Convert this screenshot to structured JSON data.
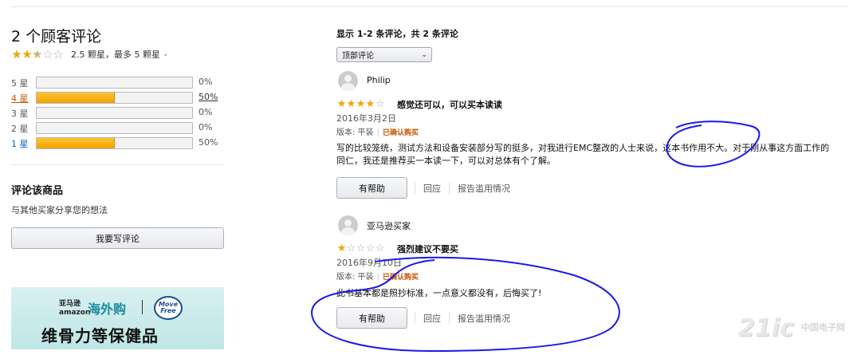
{
  "summary": {
    "title": "2 个顾客评论",
    "rating": 2.5,
    "rating_text": "2.5 颗星，最多 5 颗星",
    "caret": "⌄"
  },
  "histogram": [
    {
      "label": "5 星",
      "percent_text": "0%",
      "percent": 0,
      "link": false,
      "active": false
    },
    {
      "label": "4 星",
      "percent_text": "50%",
      "percent": 50,
      "link": true,
      "active": true
    },
    {
      "label": "3 星",
      "percent_text": "0%",
      "percent": 0,
      "link": false,
      "active": false
    },
    {
      "label": "2 星",
      "percent_text": "0%",
      "percent": 0,
      "link": false,
      "active": false
    },
    {
      "label": "1 星",
      "percent_text": "50%",
      "percent": 50,
      "link": true,
      "active": false
    }
  ],
  "review_prompt": {
    "heading": "评论该商品",
    "sub": "与其他买家分享您的想法",
    "button": "我要写评论"
  },
  "ad": {
    "brand_cn": "亚马逊",
    "brand_en": "amazon",
    "haiwai": "海外购",
    "badge_line1": "Move",
    "badge_line2": "Free",
    "headline": "维骨力等保健品"
  },
  "reviews_header": {
    "showing": "显示 1-2 条评论，共 2 条评论",
    "sort_value": "顶部评论"
  },
  "reviews": [
    {
      "name": "Philip",
      "stars": 4,
      "title": "感觉还可以，可以买本读读",
      "date": "2016年3月2日",
      "format": "版本: 平装",
      "verified": "已确认购买",
      "body": "写的比较笼统，测试方法和设备安装部分写的挺多，对我进行EMC整改的人士来说，这本书作用不大。对于刚从事这方面工作的同仁，我还是推荐买一本读一下，可以对总体有个了解。",
      "helpful": "有帮助",
      "reply": "回应",
      "report": "报告滥用情况"
    },
    {
      "name": "亚马逊买家",
      "stars": 1,
      "title": "强烈建议不要买",
      "date": "2016年9月10日",
      "format": "版本: 平装",
      "verified": "已确认购买",
      "body": "此书基本都是照抄标准，一点意义都没有，后悔买了!",
      "helpful": "有帮助",
      "reply": "回应",
      "report": "报告滥用情况"
    }
  ],
  "watermark": {
    "main": "21ic",
    "cn": "中国电子网"
  },
  "colors": {
    "star": "#f0a30a",
    "link": "#0066c0",
    "verified": "#c45500",
    "annotation": "#1a1ae6"
  }
}
